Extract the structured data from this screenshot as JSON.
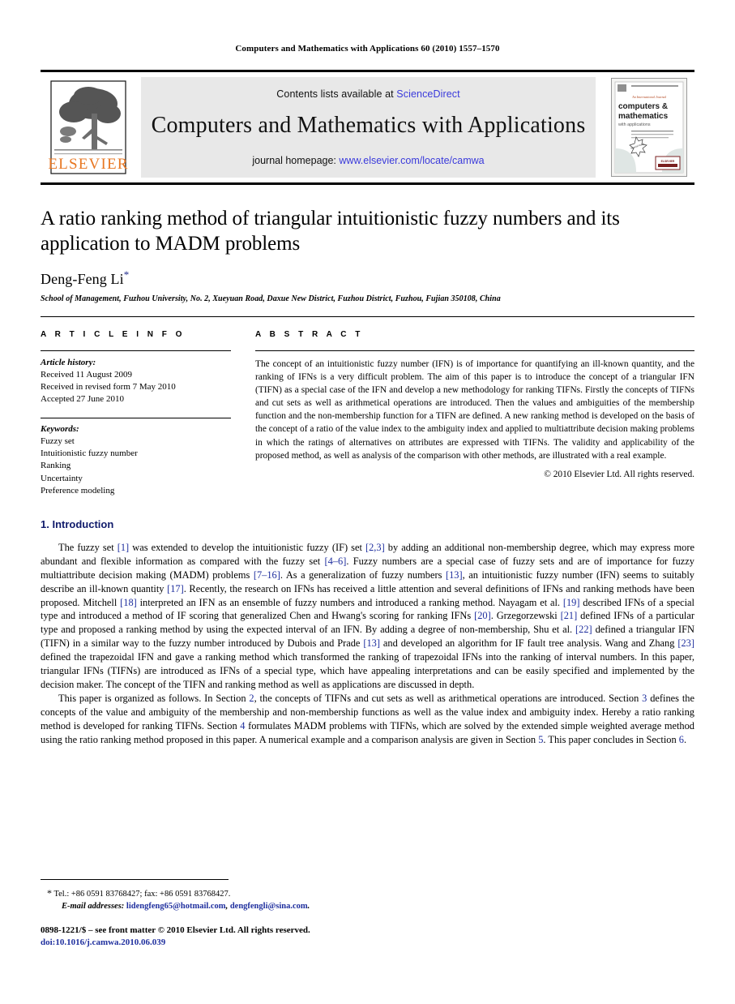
{
  "running_head": "Computers and Mathematics with Applications 60 (2010) 1557–1570",
  "masthead": {
    "publisher_logo_name": "ELSEVIER",
    "contents_prefix": "Contents lists available at ",
    "contents_link": "ScienceDirect",
    "journal_title": "Computers and Mathematics with Applications",
    "homepage_prefix": "journal homepage: ",
    "homepage_link": "www.elsevier.com/locate/camwa",
    "cover": {
      "line1": "An International Journal",
      "line2": "computers &",
      "line3": "mathematics",
      "line4": "with applications"
    },
    "link_color": "#3a3adb"
  },
  "article": {
    "title": "A ratio ranking method of triangular intuitionistic fuzzy numbers and its application to MADM problems",
    "author": "Deng-Feng Li",
    "author_marker": "*",
    "affiliation": "School of Management, Fuzhou University, No. 2, Xueyuan Road, Daxue New District, Fuzhou District, Fuzhou, Fujian 350108, China"
  },
  "info": {
    "heading": "A R T I C L E   I N F O",
    "history_label": "Article history:",
    "history": [
      "Received 11 August 2009",
      "Received in revised form 7 May 2010",
      "Accepted 27 June 2010"
    ],
    "keywords_label": "Keywords:",
    "keywords": [
      "Fuzzy set",
      "Intuitionistic fuzzy number",
      "Ranking",
      "Uncertainty",
      "Preference modeling"
    ]
  },
  "abstract": {
    "heading": "A B S T R A C T",
    "text": "The concept of an intuitionistic fuzzy number (IFN) is of importance for quantifying an ill-known quantity, and the ranking of IFNs is a very difficult problem. The aim of this paper is to introduce the concept of a triangular IFN (TIFN) as a special case of the IFN and develop a new methodology for ranking TIFNs. Firstly the concepts of TIFNs and cut sets as well as arithmetical operations are introduced. Then the values and ambiguities of the membership function and the non-membership function for a TIFN are defined. A new ranking method is developed on the basis of the concept of a ratio of the value index to the ambiguity index and applied to multiattribute decision making problems in which the ratings of alternatives on attributes are expressed with TIFNs. The validity and applicability of the proposed method, as well as analysis of the comparison with other methods, are illustrated with a real example.",
    "copyright": "© 2010 Elsevier Ltd. All rights reserved."
  },
  "section": {
    "number": "1.",
    "heading": "1.  Introduction",
    "paragraph1": [
      {
        "t": "The fuzzy set "
      },
      {
        "t": "[1]",
        "cite": true
      },
      {
        "t": " was extended to develop the intuitionistic fuzzy (IF) set "
      },
      {
        "t": "[2,3]",
        "cite": true
      },
      {
        "t": " by adding an additional non-membership degree, which may express more abundant and flexible information as compared with the fuzzy set "
      },
      {
        "t": "[4–6]",
        "cite": true
      },
      {
        "t": ". Fuzzy numbers are a special case of fuzzy sets and are of importance for fuzzy multiattribute decision making (MADM) problems "
      },
      {
        "t": "[7–16]",
        "cite": true
      },
      {
        "t": ". As a generalization of fuzzy numbers "
      },
      {
        "t": "[13]",
        "cite": true
      },
      {
        "t": ", an intuitionistic fuzzy number (IFN) seems to suitably describe an ill-known quantity "
      },
      {
        "t": "[17]",
        "cite": true
      },
      {
        "t": ". Recently, the research on IFNs has received a little attention and several definitions of IFNs and ranking methods have been proposed. Mitchell "
      },
      {
        "t": "[18]",
        "cite": true
      },
      {
        "t": " interpreted an IFN as an ensemble of fuzzy numbers and introduced a ranking method. Nayagam et al. "
      },
      {
        "t": "[19]",
        "cite": true
      },
      {
        "t": " described IFNs of a special type and introduced a method of IF scoring that generalized Chen and Hwang's scoring for ranking IFNs "
      },
      {
        "t": "[20]",
        "cite": true
      },
      {
        "t": ". Grzegorzewski "
      },
      {
        "t": "[21]",
        "cite": true
      },
      {
        "t": " defined IFNs of a particular type and proposed a ranking method by using the expected interval of an IFN. By adding a degree of non-membership, Shu et al. "
      },
      {
        "t": "[22]",
        "cite": true
      },
      {
        "t": " defined a triangular IFN (TIFN) in a similar way to the fuzzy number introduced by Dubois and Prade "
      },
      {
        "t": "[13]",
        "cite": true
      },
      {
        "t": " and developed an algorithm for IF fault tree analysis. Wang and Zhang "
      },
      {
        "t": "[23]",
        "cite": true
      },
      {
        "t": " defined the trapezoidal IFN and gave a ranking method which transformed the ranking of trapezoidal IFNs into the ranking of interval numbers. In this paper, triangular IFNs (TIFNs) are introduced as IFNs of a special type, which have appealing interpretations and can be easily specified and implemented by the decision maker. The concept of the TIFN and ranking method as well as applications are discussed in depth."
      }
    ],
    "paragraph2": [
      {
        "t": "This paper is organized as follows. In Section "
      },
      {
        "t": "2",
        "cite": true
      },
      {
        "t": ", the concepts of TIFNs and cut sets as well as arithmetical operations are introduced. Section "
      },
      {
        "t": "3",
        "cite": true
      },
      {
        "t": " defines the concepts of the value and ambiguity of the membership and non-membership functions as well as the value index and ambiguity index. Hereby a ratio ranking method is developed for ranking TIFNs. Section "
      },
      {
        "t": "4",
        "cite": true
      },
      {
        "t": " formulates MADM problems with TIFNs, which are solved by the extended simple weighted average method using the ratio ranking method proposed in this paper. A numerical example and a comparison analysis are given in Section "
      },
      {
        "t": "5",
        "cite": true
      },
      {
        "t": ". This paper concludes in Section "
      },
      {
        "t": "6",
        "cite": true
      },
      {
        "t": "."
      }
    ]
  },
  "footnotes": {
    "tel_star": "*",
    "tel_line": "Tel.: +86 0591 83768427; fax: +86 0591 83768427.",
    "email_label": "E-mail addresses:",
    "emails": [
      "lidengfeng65@hotmail.com",
      "dengfengli@sina.com"
    ],
    "imprint": "0898-1221/$ – see front matter © 2010 Elsevier Ltd. All rights reserved.",
    "doi": "doi:10.1016/j.camwa.2010.06.039"
  }
}
